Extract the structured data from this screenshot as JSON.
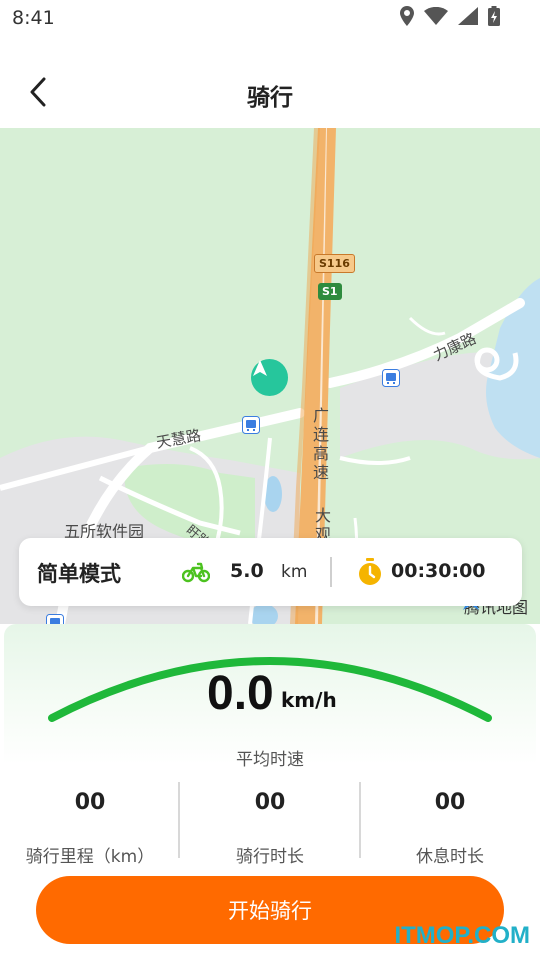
{
  "status_bar": {
    "time": "8:41",
    "icons": [
      "location-icon",
      "wifi-icon",
      "signal-icon",
      "battery-charging-icon"
    ]
  },
  "header": {
    "title": "骑行",
    "back_icon": "chevron-left-icon"
  },
  "map": {
    "labels": {
      "tianhui_road": "天慧路",
      "likang_road": "力康路",
      "guanglian_expressway": "广连高速",
      "wusuo_software_park": "五所软件园",
      "daguan": "大观",
      "road_fragment": "盱路"
    },
    "shields": {
      "s116": "S116",
      "s1": "S1"
    },
    "watermark": "腾讯地图"
  },
  "mode_card": {
    "mode_label": "简单模式",
    "distance_value": "5.0",
    "distance_unit": "km",
    "timer_value": "00:30:00",
    "bike_color": "#4cc21f",
    "timer_color": "#f5b400"
  },
  "panel": {
    "speed_value": "0.0",
    "speed_unit": "km/h",
    "avg_speed_label": "平均时速",
    "stats": [
      {
        "value": "00",
        "label": "骑行里程（km）"
      },
      {
        "value": "00",
        "label": "骑行时长"
      },
      {
        "value": "00",
        "label": "休息时长"
      }
    ],
    "start_button_label": "开始骑行",
    "site_watermark": "ITMOP.COM",
    "accent_color": "#ff6a00",
    "gauge_color": "#1fb83a"
  }
}
